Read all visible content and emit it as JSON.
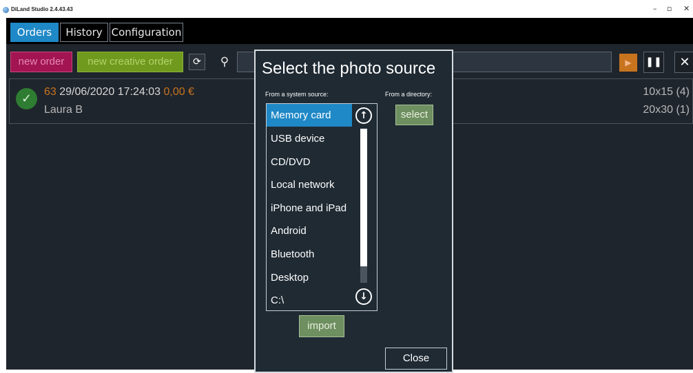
{
  "window": {
    "title": "DiLand Studio 2.4.43.43",
    "minimize": "–",
    "maximize": "▫",
    "close": "✕"
  },
  "tabs": [
    {
      "label": "Orders",
      "active": true
    },
    {
      "label": "History",
      "active": false
    },
    {
      "label": "Configuration",
      "active": false
    }
  ],
  "toolbar": {
    "new_order": "new order",
    "new_creative_order": "new creative order",
    "refresh_icon": "⟳",
    "search_icon": "⚲",
    "search_value": "",
    "play_icon": "▶",
    "pause_icon": "❚❚",
    "stop_icon": "✕"
  },
  "order": {
    "number": "63",
    "datetime": "29/06/2020 17:24:03",
    "price": "0,00 €",
    "customer": "Laura B",
    "size1": "10x15 (4)",
    "size2": "20x30 (1)",
    "status_icon": "✓"
  },
  "dialog": {
    "title": "Select the photo source",
    "system_label": "From a system source:",
    "directory_label": "From a directory:",
    "select_button": "select",
    "import_button": "import",
    "close_button": "Close",
    "scroll_up_icon": "↑",
    "scroll_down_icon": "↓",
    "sources": [
      {
        "label": "Memory card",
        "selected": true
      },
      {
        "label": "USB device",
        "selected": false
      },
      {
        "label": "CD/DVD",
        "selected": false
      },
      {
        "label": "Local network",
        "selected": false
      },
      {
        "label": "iPhone and iPad",
        "selected": false
      },
      {
        "label": "Android",
        "selected": false
      },
      {
        "label": "Bluetooth",
        "selected": false
      },
      {
        "label": "Desktop",
        "selected": false
      },
      {
        "label": "C:\\",
        "selected": false
      }
    ]
  },
  "colors": {
    "accent_blue": "#1f88c6",
    "new_order_magenta": "#a21452",
    "new_creative_green": "#709a1e",
    "orange": "#c8741e",
    "button_green": "#6e8f5f",
    "dark_bg": "#1f252c"
  }
}
